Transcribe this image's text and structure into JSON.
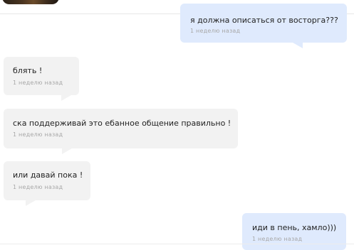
{
  "messages": [
    {
      "direction": "outgoing",
      "text": "я должна описаться от восторга???",
      "time": "1 неделю назад"
    },
    {
      "direction": "incoming",
      "text": "блять !",
      "time": "1 неделю назад"
    },
    {
      "direction": "incoming",
      "text": "ска поддерживай это ебанное общение правильно !",
      "time": "1 неделю назад"
    },
    {
      "direction": "incoming",
      "text": "или давай пока !",
      "time": "1 неделю назад"
    },
    {
      "direction": "outgoing",
      "text": "иди в пень, хамло)))",
      "time": "1 неделю назад"
    }
  ],
  "colors": {
    "incoming_bubble": "#f2f2f2",
    "outgoing_bubble": "#dfeafd",
    "timestamp": "#a8a8a8"
  }
}
